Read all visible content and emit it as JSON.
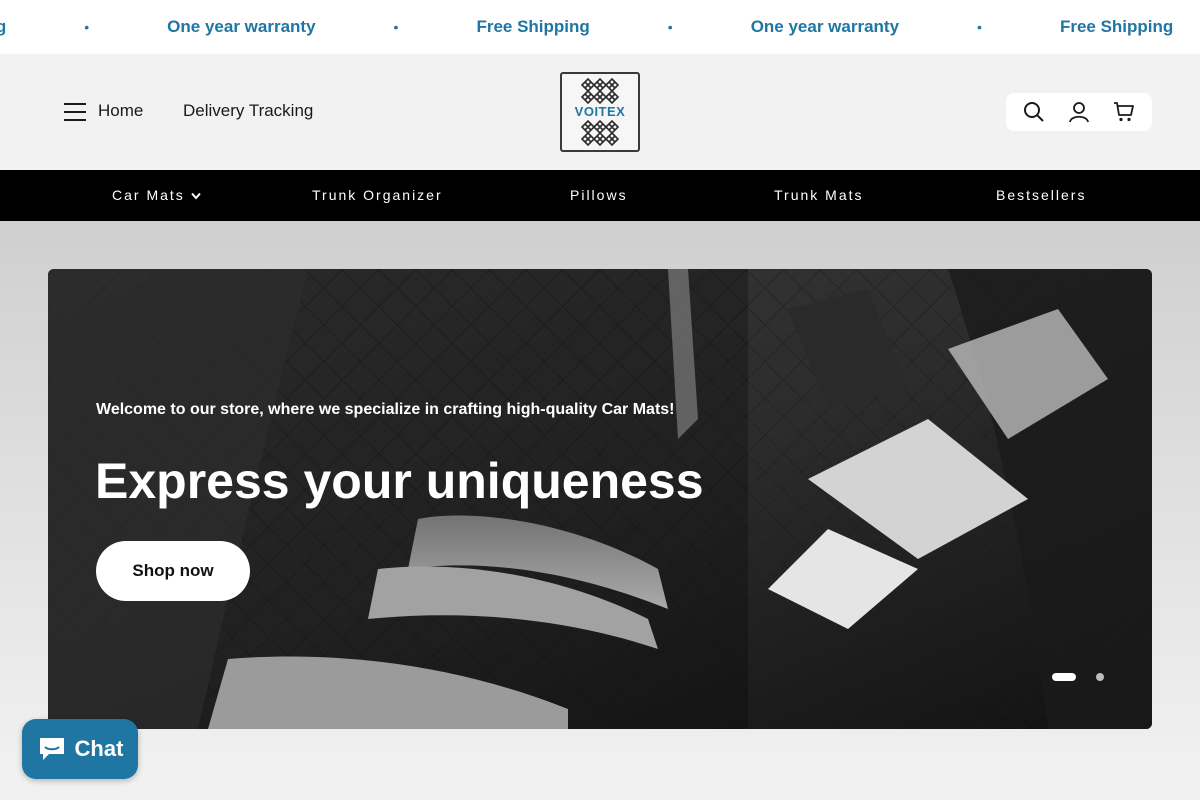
{
  "announcement": {
    "items": [
      "pping",
      "One year warranty",
      "Free Shipping",
      "One year warranty",
      "Free Shipping"
    ],
    "separator": "•",
    "color": "#1f76a3"
  },
  "header": {
    "home_label": "Home",
    "delivery_label": "Delivery Tracking",
    "logo_text": "VOITEX",
    "icons": [
      "menu-icon",
      "search-icon",
      "account-icon",
      "cart-icon"
    ]
  },
  "category_nav": {
    "items": [
      "Car Mats",
      "Trunk Organizer",
      "Pillows",
      "Trunk Mats",
      "Bestsellers"
    ]
  },
  "hero": {
    "subtitle": "Welcome to our store, where we specialize in crafting high-quality Car Mats!",
    "title": "Express your uniqueness",
    "cta_label": "Shop now",
    "slide_count": 2,
    "active_slide": 1
  },
  "chat": {
    "label": "Chat"
  },
  "colors": {
    "accent": "#1f76a3",
    "nav_bg": "#000000",
    "page_bg": "#f2f2f2"
  }
}
